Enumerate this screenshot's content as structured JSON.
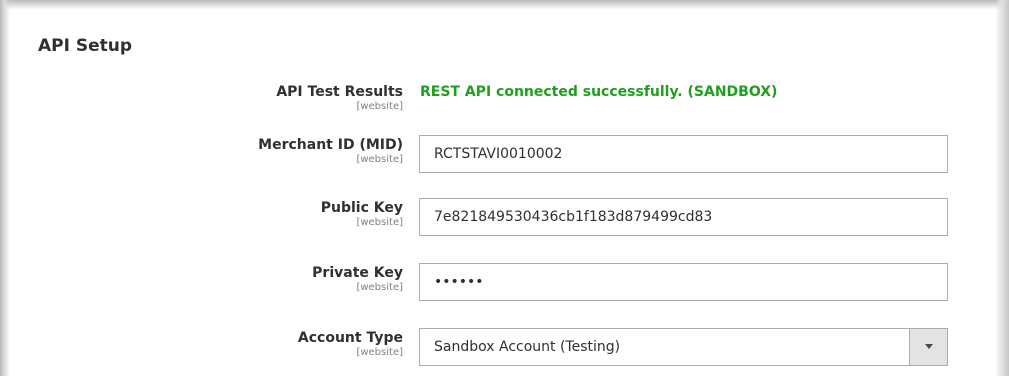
{
  "section": {
    "title": "API Setup"
  },
  "fields": {
    "api_test_results": {
      "label": "API Test Results",
      "scope": "[website]",
      "value": "REST API connected successfully. (SANDBOX)",
      "value_color": "#1f9f1f"
    },
    "merchant_id": {
      "label": "Merchant ID (MID)",
      "scope": "[website]",
      "value": "RCTSTAVI0010002"
    },
    "public_key": {
      "label": "Public Key",
      "scope": "[website]",
      "value": "7e821849530436cb1f183d879499cd83"
    },
    "private_key": {
      "label": "Private Key",
      "scope": "[website]",
      "value": "••••••"
    },
    "account_type": {
      "label": "Account Type",
      "scope": "[website]",
      "selected": "Sandbox Account (Testing)",
      "icon": "chevron-down-icon"
    }
  }
}
